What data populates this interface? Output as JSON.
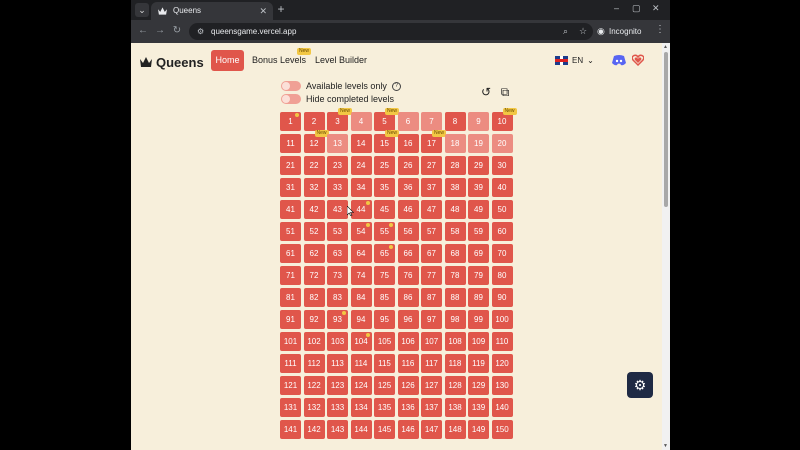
{
  "browser": {
    "tab_title": "Queens",
    "tab_menu_icon": "chevron-down-icon",
    "close_label": "✕",
    "new_tab_label": "+",
    "url": "queensgame.vercel.app",
    "incognito_label": "Incognito"
  },
  "header": {
    "title": "Queens",
    "nav": [
      {
        "label": "Home",
        "active": true
      },
      {
        "label": "Bonus Levels",
        "active": false,
        "badge": "New"
      },
      {
        "label": "Level Builder",
        "active": false
      }
    ],
    "language": "EN"
  },
  "filters": {
    "available_only_label": "Available levels only",
    "hide_completed_label": "Hide completed levels"
  },
  "levels": {
    "new_badge_label": "New",
    "cells": [
      {
        "n": "1",
        "light": false,
        "star": true
      },
      {
        "n": "2",
        "light": false
      },
      {
        "n": "3",
        "light": false,
        "badge": true
      },
      {
        "n": "4",
        "light": true
      },
      {
        "n": "5",
        "light": false,
        "badge": true
      },
      {
        "n": "6",
        "light": true
      },
      {
        "n": "7",
        "light": true
      },
      {
        "n": "8",
        "light": false
      },
      {
        "n": "9",
        "light": true
      },
      {
        "n": "10",
        "light": false,
        "badge": true
      },
      {
        "n": "11",
        "light": false
      },
      {
        "n": "12",
        "light": false,
        "badge": true
      },
      {
        "n": "13",
        "light": true
      },
      {
        "n": "14",
        "light": false
      },
      {
        "n": "15",
        "light": false,
        "badge": true
      },
      {
        "n": "16",
        "light": false
      },
      {
        "n": "17",
        "light": false,
        "badge": true
      },
      {
        "n": "18",
        "light": true
      },
      {
        "n": "19",
        "light": true
      },
      {
        "n": "20",
        "light": true
      },
      {
        "n": "21"
      },
      {
        "n": "22"
      },
      {
        "n": "23"
      },
      {
        "n": "24"
      },
      {
        "n": "25"
      },
      {
        "n": "26"
      },
      {
        "n": "27"
      },
      {
        "n": "28"
      },
      {
        "n": "29"
      },
      {
        "n": "30"
      },
      {
        "n": "31"
      },
      {
        "n": "32"
      },
      {
        "n": "33"
      },
      {
        "n": "34"
      },
      {
        "n": "35"
      },
      {
        "n": "36"
      },
      {
        "n": "37"
      },
      {
        "n": "38"
      },
      {
        "n": "39"
      },
      {
        "n": "40"
      },
      {
        "n": "41"
      },
      {
        "n": "42"
      },
      {
        "n": "43"
      },
      {
        "n": "44",
        "star": true
      },
      {
        "n": "45"
      },
      {
        "n": "46"
      },
      {
        "n": "47"
      },
      {
        "n": "48"
      },
      {
        "n": "49"
      },
      {
        "n": "50"
      },
      {
        "n": "51"
      },
      {
        "n": "52"
      },
      {
        "n": "53"
      },
      {
        "n": "54",
        "star": true
      },
      {
        "n": "55",
        "star": true
      },
      {
        "n": "56"
      },
      {
        "n": "57"
      },
      {
        "n": "58"
      },
      {
        "n": "59"
      },
      {
        "n": "60"
      },
      {
        "n": "61"
      },
      {
        "n": "62"
      },
      {
        "n": "63"
      },
      {
        "n": "64"
      },
      {
        "n": "65",
        "star": true
      },
      {
        "n": "66"
      },
      {
        "n": "67"
      },
      {
        "n": "68"
      },
      {
        "n": "69"
      },
      {
        "n": "70"
      },
      {
        "n": "71"
      },
      {
        "n": "72"
      },
      {
        "n": "73"
      },
      {
        "n": "74"
      },
      {
        "n": "75"
      },
      {
        "n": "76"
      },
      {
        "n": "77"
      },
      {
        "n": "78"
      },
      {
        "n": "79"
      },
      {
        "n": "80"
      },
      {
        "n": "81"
      },
      {
        "n": "82"
      },
      {
        "n": "83"
      },
      {
        "n": "84"
      },
      {
        "n": "85"
      },
      {
        "n": "86"
      },
      {
        "n": "87"
      },
      {
        "n": "88"
      },
      {
        "n": "89"
      },
      {
        "n": "90"
      },
      {
        "n": "91"
      },
      {
        "n": "92"
      },
      {
        "n": "93",
        "star": true
      },
      {
        "n": "94"
      },
      {
        "n": "95"
      },
      {
        "n": "96"
      },
      {
        "n": "97"
      },
      {
        "n": "98"
      },
      {
        "n": "99"
      },
      {
        "n": "100"
      },
      {
        "n": "101"
      },
      {
        "n": "102"
      },
      {
        "n": "103"
      },
      {
        "n": "104",
        "star": true
      },
      {
        "n": "105"
      },
      {
        "n": "106"
      },
      {
        "n": "107"
      },
      {
        "n": "108"
      },
      {
        "n": "109"
      },
      {
        "n": "110"
      },
      {
        "n": "111"
      },
      {
        "n": "112"
      },
      {
        "n": "113"
      },
      {
        "n": "114"
      },
      {
        "n": "115"
      },
      {
        "n": "116"
      },
      {
        "n": "117"
      },
      {
        "n": "118"
      },
      {
        "n": "119"
      },
      {
        "n": "120"
      },
      {
        "n": "121"
      },
      {
        "n": "122"
      },
      {
        "n": "123"
      },
      {
        "n": "124"
      },
      {
        "n": "125"
      },
      {
        "n": "126"
      },
      {
        "n": "127"
      },
      {
        "n": "128"
      },
      {
        "n": "129"
      },
      {
        "n": "130"
      },
      {
        "n": "131"
      },
      {
        "n": "132"
      },
      {
        "n": "133"
      },
      {
        "n": "134"
      },
      {
        "n": "135"
      },
      {
        "n": "136"
      },
      {
        "n": "137"
      },
      {
        "n": "138"
      },
      {
        "n": "139"
      },
      {
        "n": "140"
      },
      {
        "n": "141"
      },
      {
        "n": "142"
      },
      {
        "n": "143"
      },
      {
        "n": "144"
      },
      {
        "n": "145"
      },
      {
        "n": "146"
      },
      {
        "n": "147"
      },
      {
        "n": "148"
      },
      {
        "n": "149"
      },
      {
        "n": "150"
      }
    ]
  },
  "colors": {
    "accent": "#e0564b",
    "accent_light": "#ec8c81",
    "background": "#f7efdb",
    "badge": "#f2c744"
  }
}
